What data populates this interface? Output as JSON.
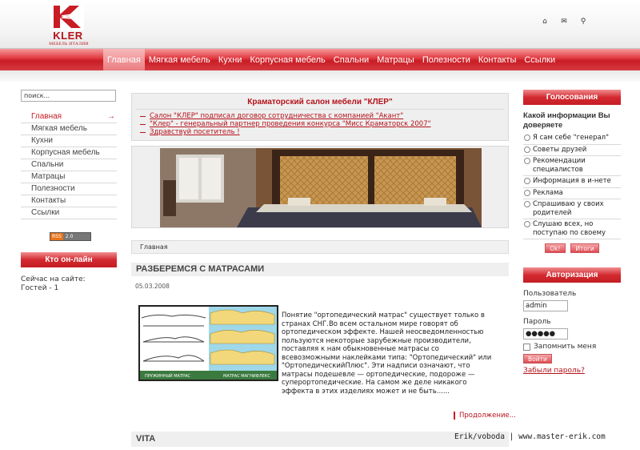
{
  "header": {
    "logo_text": "KLER",
    "logo_sub": "МЕБЕЛЬ ИТАЛИИ",
    "icons": [
      "home-icon",
      "mail-icon",
      "search-icon"
    ]
  },
  "nav": {
    "items": [
      "Главная",
      "Мягкая мебель",
      "Кухни",
      "Корпусная мебель",
      "Спальни",
      "Матрацы",
      "Полезности",
      "Контакты",
      "Ссылки"
    ],
    "active": 0
  },
  "left": {
    "search_value": "поиск...",
    "menu": [
      "Главная",
      "Мягкая мебель",
      "Кухни",
      "Корпусная мебель",
      "Спальни",
      "Матрацы",
      "Полезности",
      "Контакты",
      "Ссылки"
    ],
    "rss_a": "RSS",
    "rss_b": "2.0",
    "who_title": "Кто он-лайн",
    "who_line1": "Сейчас на сайте:",
    "who_line2": "Гостей - 1"
  },
  "center": {
    "news_title": "Краматорский салон мебели \"КЛЕР\"",
    "news": [
      "Салон \"КЛЕР\" подписал договор сотрудничества с компанией \"Акант\"",
      "\"Клер\" - генеральный партнер проведения конкурса \"Мисс Краматорск 2007\"",
      "Здравствуй посетитель !"
    ],
    "breadcrumb": "Главная",
    "article_title": "РАЗБЕРЕМСЯ С МАТРАСАМИ",
    "article_date": "05.03.2008",
    "image_caption_left": "ПРУЖИННЫЙ МАТРАС",
    "image_caption_right": "МАТРАС МАГНИФЛЕКС",
    "article_text": "Понятие \"ортопедический матрас\" существует только в странах СНГ.Во всем остальном мире говорят об ортопедическом эффекте. Нашей неосведомленностью пользуются некоторые зарубежные производители, поставляя к нам обыкновенные матрасы со всевозможными наклейками типа: \"Ортопедический\" или \"ОртопедическийПлюс\". Эти надписи означают, что матрасы подешевле — ортопедические, подороже — суперортопедические. На самом же деле никакого эффекта в этих изделиях может и не быть......",
    "more": "Продолжение...",
    "next_title": "VITA"
  },
  "right": {
    "poll_title": "Голосования",
    "poll_question": "Какой информации Вы доверяете",
    "poll_options": [
      "Я сам себе \"генерал\"",
      "Советы друзей",
      "Рекомендации специалистов",
      "Информация в и-нете",
      "Реклама",
      "Спрашиваю у своих родителей",
      "Слушаю всех, но поступаю по своему"
    ],
    "poll_vote": "Ok!",
    "poll_results": "Итоги",
    "auth_title": "Авторизация",
    "user_label": "Пользователь",
    "user_value": "admin",
    "pass_label": "Пароль",
    "pass_value": "●●●●●",
    "remember": "Запомнить меня",
    "login_btn": "Войти",
    "forgot": "Забыли пароль?"
  },
  "watermark": "Erik/voboda | www.master-erik.com",
  "colors": {
    "accent": "#c81d25",
    "link": "#b5121b"
  }
}
